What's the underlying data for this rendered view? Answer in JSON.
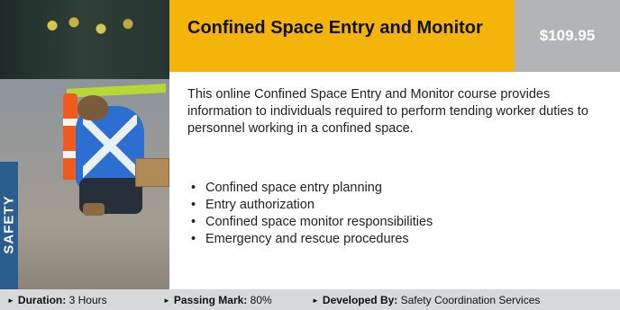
{
  "course": {
    "category": "SAFETY",
    "title": "Confined Space Entry and Monitor",
    "price": "$109.95",
    "description": "This online Confined Space Entry and Monitor course provides information to individuals required to perform tending worker duties to personnel working in a confined space.",
    "topics": [
      "Confined space entry planning",
      "Entry authorization",
      "Confined space monitor responsibilities",
      "Emergency and rescue procedures"
    ]
  },
  "footer": {
    "duration_label": "Duration:",
    "duration_value": "3 Hours",
    "passing_label": "Passing Mark:",
    "passing_value": "80%",
    "developer_label": "Developed By:",
    "developer_value": "Safety Coordination Services"
  },
  "colors": {
    "title_bar": "#f5b40a",
    "price_bar": "#b2b4b6",
    "category_strip": "#2c5d8f",
    "footer": "#d8d9db"
  },
  "icons": {
    "footer_bullets": "triangle-right-icon"
  }
}
